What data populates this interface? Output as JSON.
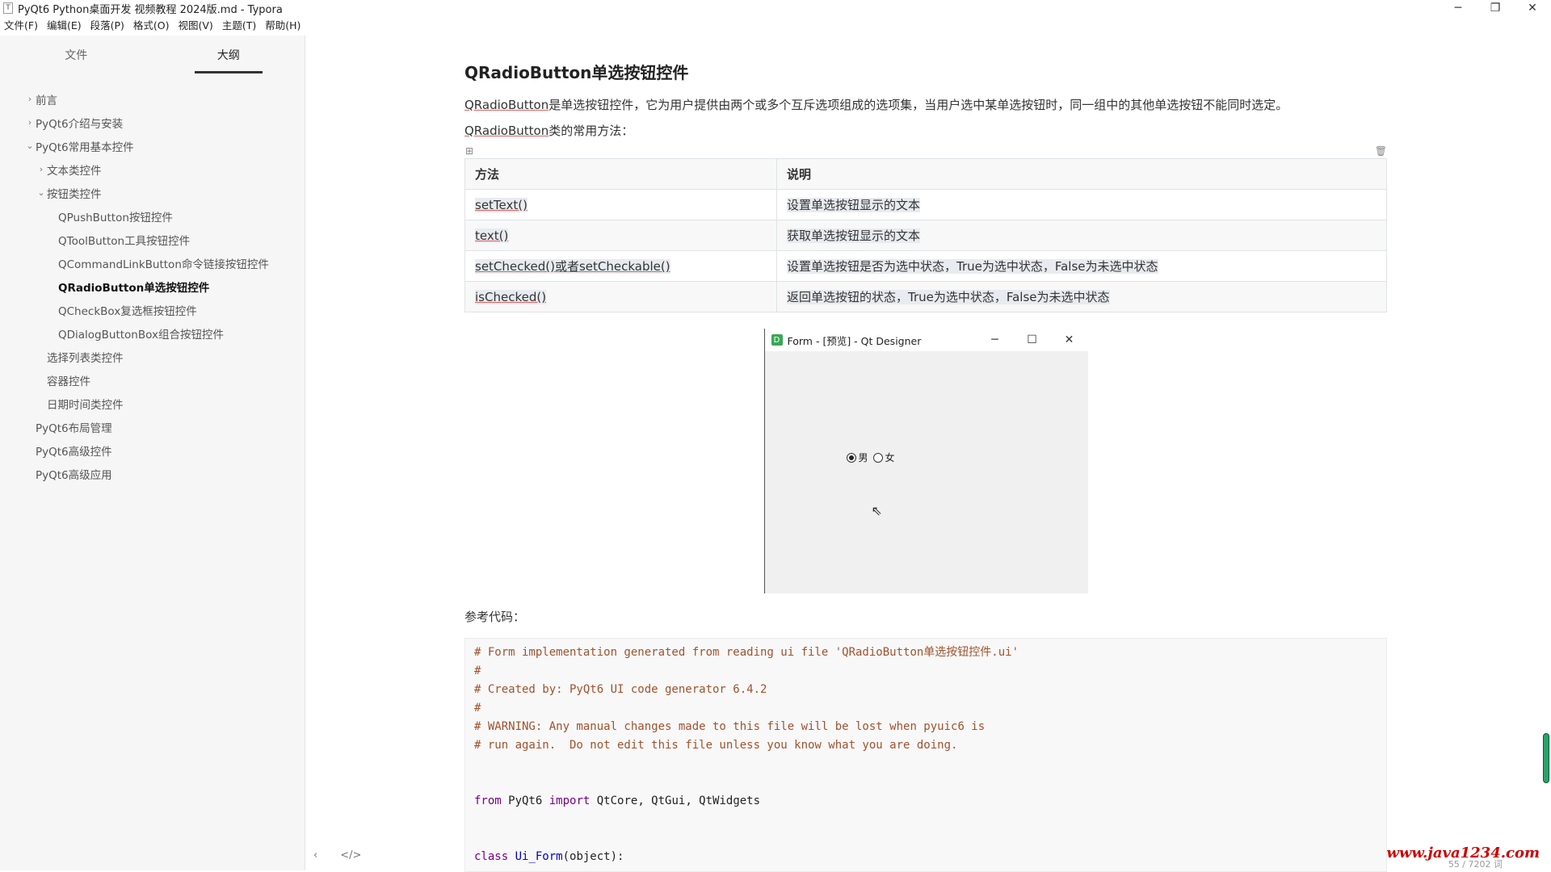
{
  "window": {
    "title": "PyQt6 Python桌面开发 视频教程 2024版.md - Typora",
    "app_icon": "T",
    "minimize": "─",
    "maximize": "❐",
    "close": "✕"
  },
  "menu": [
    "文件(F)",
    "编辑(E)",
    "段落(P)",
    "格式(O)",
    "视图(V)",
    "主题(T)",
    "帮助(H)"
  ],
  "sidebar": {
    "tabs": [
      "文件",
      "大纲"
    ],
    "active_tab": "大纲",
    "outline": [
      {
        "label": "前言",
        "caret": "›",
        "indent": 0
      },
      {
        "label": "PyQt6介绍与安装",
        "caret": "›",
        "indent": 0
      },
      {
        "label": "PyQt6常用基本控件",
        "caret": "⌄",
        "indent": 0
      },
      {
        "label": "文本类控件",
        "caret": "›",
        "indent": 1
      },
      {
        "label": "按钮类控件",
        "caret": "⌄",
        "indent": 1
      },
      {
        "label": "QPushButton按钮控件",
        "caret": "",
        "indent": 2
      },
      {
        "label": "QToolButton工具按钮控件",
        "caret": "",
        "indent": 2
      },
      {
        "label": "QCommandLinkButton命令链接按钮控件",
        "caret": "",
        "indent": 2
      },
      {
        "label": "QRadioButton单选按钮控件",
        "caret": "",
        "indent": 2,
        "active": true
      },
      {
        "label": "QCheckBox复选框按钮控件",
        "caret": "",
        "indent": 2
      },
      {
        "label": "QDialogButtonBox组合按钮控件",
        "caret": "",
        "indent": 2
      },
      {
        "label": "选择列表类控件",
        "caret": "",
        "indent": 1
      },
      {
        "label": "容器控件",
        "caret": "",
        "indent": 1
      },
      {
        "label": "日期时间类控件",
        "caret": "",
        "indent": 1
      },
      {
        "label": "PyQt6布局管理",
        "caret": "",
        "indent": 0
      },
      {
        "label": "PyQt6高级控件",
        "caret": "",
        "indent": 0
      },
      {
        "label": "PyQt6高级应用",
        "caret": "",
        "indent": 0
      }
    ],
    "footer_back": "‹",
    "footer_source": "</>"
  },
  "content": {
    "heading": "QRadioButton单选按钮控件",
    "intro_term": "QRadioButton",
    "intro_rest": "是单选按钮控件，它为用户提供由两个或多个互斥选项组成的选项集，当用户选中某单选按钮时，同一组中的其他单选按钮不能同时选定。",
    "methods_term": "QRadioButton",
    "methods_rest": "类的常用方法：",
    "table": {
      "headers": [
        "方法",
        "说明"
      ],
      "rows": [
        [
          "setText()",
          "设置单选按钮显示的文本"
        ],
        [
          "text()",
          "获取单选按钮显示的文本"
        ],
        [
          "setChecked()或者setCheckable()",
          "设置单选按钮是否为选中状态，True为选中状态，False为未选中状态"
        ],
        [
          "isChecked()",
          "返回单选按钮的状态，True为选中状态，False为未选中状态"
        ]
      ]
    },
    "preview": {
      "title": "Form - [预览] - Qt Designer",
      "icon": "D",
      "minimize": "─",
      "maximize": "☐",
      "close": "✕",
      "radio_male": "男",
      "radio_female": "女",
      "male_checked": true
    },
    "code_label": "参考代码：",
    "code_lines": [
      {
        "type": "cm",
        "text": "# Form implementation generated from reading ui file 'QRadioButton单选按钮控件.ui'"
      },
      {
        "type": "cm",
        "text": "#"
      },
      {
        "type": "cm",
        "text": "# Created by: PyQt6 UI code generator 6.4.2"
      },
      {
        "type": "cm",
        "text": "#"
      },
      {
        "type": "cm",
        "text": "# WARNING: Any manual changes made to this file will be lost when pyuic6 is"
      },
      {
        "type": "cm",
        "text": "# run again.  Do not edit this file unless you know what you are doing."
      },
      {
        "type": "blank",
        "text": ""
      },
      {
        "type": "blank",
        "text": ""
      },
      {
        "type": "import",
        "kw1": "from",
        "mod": " PyQt6 ",
        "kw2": "import",
        "rest": " QtCore, QtGui, QtWidgets"
      },
      {
        "type": "blank",
        "text": ""
      },
      {
        "type": "blank",
        "text": ""
      },
      {
        "type": "class",
        "kw": "class",
        "name": " Ui_Form",
        "rest": "(object):"
      }
    ]
  },
  "watermark": "www.java1234.com",
  "wordcount": "55 / 7202 词"
}
